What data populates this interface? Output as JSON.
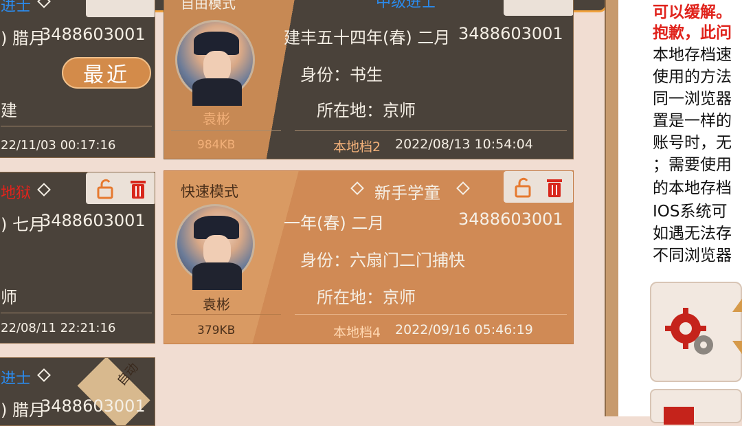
{
  "recent_button": "最近",
  "auto_badge": "自动",
  "left_col": {
    "card1": {
      "mode": "进士",
      "date_frag": ") 腊月",
      "id": "3488603001",
      "place_frag": "建",
      "ts": "22/11/03 00:17:16"
    },
    "card2": {
      "mode": "地狱",
      "date_frag": ") 七月",
      "id": "3488603001",
      "place_frag": "师",
      "ts": "22/08/11 22:21:16"
    },
    "card3": {
      "mode": "进士",
      "date_frag": ") 腊月",
      "id": "3488603001"
    }
  },
  "card_top": {
    "mode": "自由模式",
    "level": "中级进士",
    "date": "建丰五十四年(春) 二月",
    "id": "3488603001",
    "identity": "身份：书生",
    "location": "所在地：京师",
    "name": "袁彬",
    "size": "984KB",
    "slot": "本地档2",
    "timestamp": "2022/08/13 10:54:04"
  },
  "card_mid": {
    "mode": "快速模式",
    "level": "新手学童",
    "date": "一年(春) 二月",
    "id": "3488603001",
    "identity": "身份：六扇门二门捕快",
    "location": "所在地：京师",
    "name": "袁彬",
    "size": "379KB",
    "slot": "本地档4",
    "timestamp": "2022/09/16 05:46:19"
  },
  "panel": {
    "line1": "可以缓解。",
    "line2": "抱歉，此问",
    "line3": "本地存档速",
    "line4": "使用的方法",
    "line5": "同一浏览器",
    "line6": "置是一样的",
    "line7": "账号时，无",
    "line8": "；需要使用",
    "line9": "的本地存档",
    "line10": "IOS系统可",
    "line11": "如遇无法存",
    "line12": "不同浏览器"
  },
  "colors": {
    "accent": "#f0a13c",
    "dark_card": "#4a423a",
    "light_card": "#d08a55",
    "red": "#e0231c",
    "blue": "#2a8cf0"
  }
}
